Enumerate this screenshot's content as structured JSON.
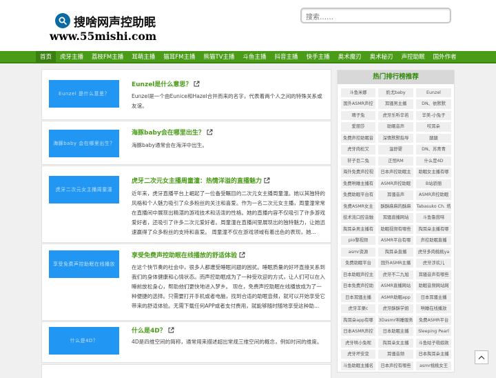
{
  "logo": {
    "name": "搜啥网声控助眠",
    "url": "www.55mishi.com"
  },
  "search": {
    "placeholder": "搜索……"
  },
  "nav": [
    "首页",
    "虎牙主播",
    "荔枝FM主播",
    "耳萌主播",
    "猫耳FM主播",
    "熊猫TV主播",
    "斗鱼主播",
    "抖音主播",
    "快手主播",
    "奥术魔刃",
    "奥术秘刃",
    "声控助眠",
    "国外作者"
  ],
  "posts": [
    {
      "thumb": "Eunzel 是什么意思？",
      "title": "Eunzel是什么意思？",
      "desc": "Eunzel是一个由Eunice和Hazel合并而来的名字，代表着两个人之间的特殊关系或友谊。"
    },
    {
      "thumb": "海豚baby 会在哪里出生？",
      "title": "海豚baby会在哪里出生？",
      "desc": "海豚baby通常会在海洋中出生。"
    },
    {
      "thumb": "虎牙二次元女主播周童潼",
      "title": "虎牙二次元女主播周童潼：热情洋溢的直播魅力",
      "desc": "近年来，虎牙直播平台上崛起了一位备受瞩目的二次元女主播周童潼。她以其独特的风格和个人魅力吸引了众多粉丝的关注和喜爱。作为一名二次元女主播，周童潼常常在直播间中展现出精湛的游戏技术和活泼的性格。她的直播内容不仅吸引了许多游戏爱好者，还吸引了许多二次元爱好者。周童潼在直播间里展现出的独特魅力，让她迅速赢得了众多粉丝的支持和喜爱。 周童潼不仅在游戏领域有着出色的表现，她..."
    },
    {
      "thumb": "享受免费声控助眠在线播放",
      "title": "享受免费声控助眠在线播放的舒适体验",
      "desc": "在这个快节奏的社会中，很多人都遭受睡眠问题的困扰。睡眠质量的好坏直接关系到我们的身体健康和心情状态。而声控助眠成为了一种受欢迎的方式，让人们可以在入睡前放松身心，帮助他们更快地进入梦乡。 现在，免费声控助眠在线播放成为了一种便捷的选择。只需要打开手机或者电脑，找到合适的助眠音频，就可以开始享受它带来的舒适体验。无需下载任何APP或者支付费用，就能够随时随地享受这种助..."
    },
    {
      "thumb": "什么是4D？",
      "title": "什么是4D？",
      "desc": "4D是四维空间的简称，通常用来描述超出常规三维空间的概念，例如时间的维度。"
    }
  ],
  "sidebar": {
    "title": "热门排行榜推荐",
    "tags": [
      "斗鱼米娜",
      "奶尤baby",
      "Eunzel",
      "国外ASMR声控",
      "耳骚男主播",
      "DN、依默默",
      "晴子兔",
      "虎牙乐听辛若",
      "华美-小兔子",
      "爱朋莎",
      "助眠音声",
      "咬耳朵",
      "免费声控助眠音",
      "深情默默指导",
      "腿腿",
      "虎牙肉松又",
      "温舒婴",
      "DN、苏青青",
      "轩子巨二兔",
      "正恒RM",
      "什么是4D",
      "海外免费声控视",
      "日本声控助眠主",
      "助眠女主播有哪",
      "免费哄睡主播有",
      "ASMR声控助眠",
      "B站骄丽",
      "免费助眠平台有",
      "耳骚音声",
      "ASMR声控助眠",
      "免费ASMR女主",
      "酥酥麻麻的酥麻",
      "Tabasuko Ch. 塔",
      "技术流口腔音触",
      "耳骚直播网站",
      "斗鱼鲁茵味",
      "掏耳朵男主播有",
      "助眠视频有哪些",
      "掏耳朵主播有哪",
      "pio黎视频",
      "ASMR平台有哪",
      "声控助眠直播",
      "asmr资源",
      "掏耳朵直播",
      "虎牙多肉桃桃ya",
      "免费助眠平台",
      "国外ASMR主播",
      "虎牙涉欢儿",
      "日本助眠声控主",
      "虎牙不二九旭",
      "耳骚音声有哪些",
      "日本免费声控助",
      "ASMR直播网站",
      "助眠音频网站网",
      "日本耳骚主播",
      "ASMR助眠app",
      "日本耳骚主播",
      "虎牙羊栗c",
      "虎牙酥酥学姐",
      "哄睡在线播放",
      "掏耳朵app有哪",
      "3Dasmr哄睡服务",
      "免费ASMR平台",
      "日本ASMR声控",
      "日本助眠主播",
      "Sleeping Pearl",
      "虎牙哄小兔呢",
      "掏耳朵女主播",
      "斗鱼姑子萌娘款",
      "虎牙坏安变",
      "耳骚音频",
      "日本掏耳朵主播",
      "斗鱼助眠主播名",
      "日本声控有哪些",
      "asmr桃桃女王"
    ]
  }
}
